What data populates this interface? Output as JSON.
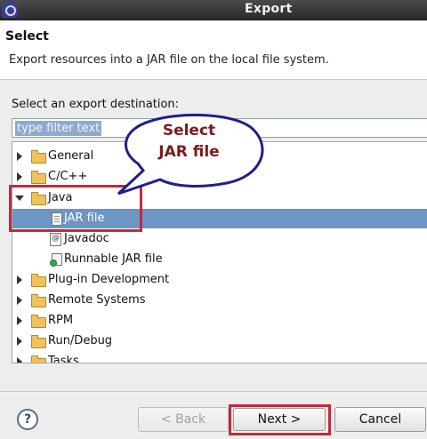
{
  "window": {
    "title": "Export"
  },
  "header": {
    "title": "Select",
    "description": "Export resources into a JAR file on the local file system."
  },
  "destination_label": "Select an export destination:",
  "filter": {
    "placeholder": "type filter text"
  },
  "tree": {
    "items": [
      {
        "label": "General",
        "icon": "folder-icon",
        "expanded": false
      },
      {
        "label": "C/C++",
        "icon": "folder-icon",
        "expanded": false
      },
      {
        "label": "Java",
        "icon": "folder-icon",
        "expanded": true
      },
      {
        "label": "JAR file",
        "icon": "jar-file-icon",
        "selected": true
      },
      {
        "label": "Javadoc",
        "icon": "javadoc-icon"
      },
      {
        "label": "Runnable JAR file",
        "icon": "runnable-jar-icon"
      },
      {
        "label": "Plug-in Development",
        "icon": "folder-icon",
        "expanded": false
      },
      {
        "label": "Remote Systems",
        "icon": "folder-icon",
        "expanded": false
      },
      {
        "label": "RPM",
        "icon": "folder-icon",
        "expanded": false
      },
      {
        "label": "Run/Debug",
        "icon": "folder-icon",
        "expanded": false
      },
      {
        "label": "Tasks",
        "icon": "folder-icon",
        "expanded": false
      }
    ]
  },
  "callout": {
    "line1": "Select",
    "line2": "JAR file"
  },
  "buttons": {
    "help": "?",
    "back": "< Back",
    "next": "Next >",
    "cancel": "Cancel"
  },
  "colors": {
    "selection": "#6d95c6",
    "highlight_box": "#c7273a",
    "callout_border": "#1f1f8c",
    "callout_text": "#7a1b1b"
  }
}
